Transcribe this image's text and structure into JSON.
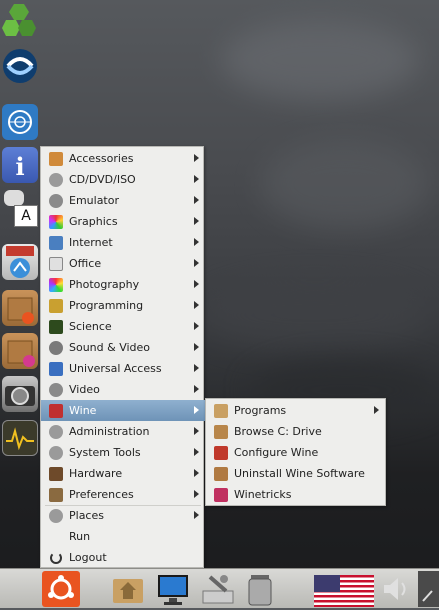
{
  "tooltip": {
    "text": "A"
  },
  "menu": {
    "items": [
      {
        "label": "Accessories",
        "icon": "accessories-icon",
        "has_submenu": true
      },
      {
        "label": "CD/DVD/ISO",
        "icon": "disc-icon",
        "has_submenu": true
      },
      {
        "label": "Emulator",
        "icon": "emulator-icon",
        "has_submenu": true
      },
      {
        "label": "Graphics",
        "icon": "graphics-icon",
        "has_submenu": true
      },
      {
        "label": "Internet",
        "icon": "internet-icon",
        "has_submenu": true
      },
      {
        "label": "Office",
        "icon": "office-icon",
        "has_submenu": true
      },
      {
        "label": "Photography",
        "icon": "photography-icon",
        "has_submenu": true
      },
      {
        "label": "Programming",
        "icon": "programming-icon",
        "has_submenu": true
      },
      {
        "label": "Science",
        "icon": "science-icon",
        "has_submenu": true
      },
      {
        "label": "Sound & Video",
        "icon": "sound-video-icon",
        "has_submenu": true
      },
      {
        "label": "Universal Access",
        "icon": "universal-access-icon",
        "has_submenu": true
      },
      {
        "label": "Video",
        "icon": "video-icon",
        "has_submenu": true
      },
      {
        "label": "Wine",
        "icon": "wine-icon",
        "has_submenu": true,
        "selected": true
      },
      {
        "label": "Administration",
        "icon": "administration-icon",
        "has_submenu": true
      },
      {
        "label": "System Tools",
        "icon": "system-tools-icon",
        "has_submenu": true
      },
      {
        "label": "Hardware",
        "icon": "hardware-icon",
        "has_submenu": true
      },
      {
        "label": "Preferences",
        "icon": "preferences-icon",
        "has_submenu": true
      },
      {
        "label": "Places",
        "icon": "places-icon",
        "has_submenu": true
      },
      {
        "label": "Run",
        "icon": "",
        "has_submenu": false
      },
      {
        "label": "Logout",
        "icon": "logout-icon",
        "has_submenu": false
      }
    ]
  },
  "wine_submenu": {
    "items": [
      {
        "label": "Programs",
        "icon": "folder-icon",
        "has_submenu": true
      },
      {
        "label": "Browse C: Drive",
        "icon": "browse-drive-icon",
        "has_submenu": false
      },
      {
        "label": "Configure Wine",
        "icon": "configure-wine-icon",
        "has_submenu": false
      },
      {
        "label": "Uninstall Wine Software",
        "icon": "uninstall-icon",
        "has_submenu": false
      },
      {
        "label": "Winetricks",
        "icon": "winetricks-icon",
        "has_submenu": false
      }
    ]
  },
  "colors": {
    "selection": "#7a9dc0",
    "menu_bg": "#eeeeec",
    "ubuntu_orange": "#e95420"
  }
}
